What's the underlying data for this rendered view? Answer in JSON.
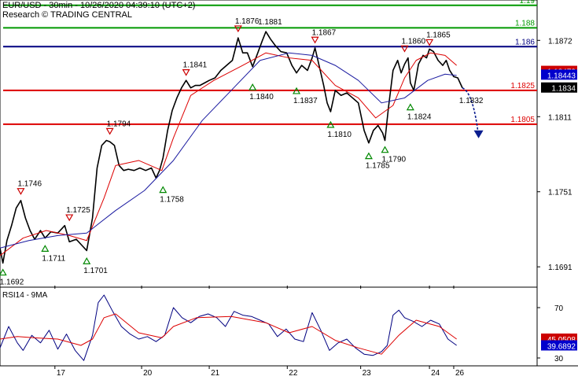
{
  "header": {
    "title": "EUR/USD - 30min - 10/26/2020 04:39:10 (UTC+2)",
    "subtitle": "Research © TRADING CENTRAL"
  },
  "colors": {
    "price": "#000000",
    "ma_fast": "#dd0000",
    "ma_slow": "#1a1aa0",
    "resistance": "#009900",
    "pivot": "#000080",
    "support": "#dd0000",
    "arrow": "#0a1d8f",
    "axis_box_pivot": "#0000cc",
    "axis_box_last": "#000000",
    "axis_box_red": "#cc0000",
    "tri_up": "#008800",
    "tri_down": "#cc0000"
  },
  "chart_data": [
    {
      "type": "line",
      "panel": "price",
      "title": "EUR/USD - 30min - 10/26/2020 04:39:10 (UTC+2)",
      "ylim": [
        1.1676,
        1.1903
      ],
      "y_ticks": [
        "1.1872",
        "1.1811",
        "1.1751",
        "1.1691"
      ],
      "y_tick_values": [
        1.1872,
        1.1811,
        1.1751,
        1.1691
      ],
      "x_ticks": [
        "17",
        "20",
        "21",
        "22",
        "23",
        "24",
        "26"
      ],
      "x_tick_values": [
        0.095,
        0.245,
        0.362,
        0.497,
        0.624,
        0.743,
        0.785
      ],
      "key_levels": [
        {
          "label": "1.19",
          "value": 1.19,
          "kind": "resistance"
        },
        {
          "label": "1.188",
          "value": 1.1882,
          "kind": "resistance"
        },
        {
          "label": "1.186",
          "value": 1.1867,
          "kind": "pivot"
        },
        {
          "label": "1.1825",
          "value": 1.1832,
          "kind": "support"
        },
        {
          "label": "1.1805",
          "value": 1.1805,
          "kind": "support"
        }
      ],
      "axis_boxes": [
        {
          "label": "1.18473",
          "value": 1.18473,
          "kind": "red"
        },
        {
          "label": "1.18443",
          "value": 1.18443,
          "kind": "pivot"
        },
        {
          "label": "1.1834",
          "value": 1.1834,
          "kind": "last"
        }
      ],
      "annotations": [
        {
          "label": "1.1692",
          "x": 0.005,
          "y": 1.1692,
          "marker": "up"
        },
        {
          "label": "1.1746",
          "x": 0.036,
          "y": 1.1746,
          "marker": "down"
        },
        {
          "label": "1.1711",
          "x": 0.078,
          "y": 1.1711,
          "marker": "up"
        },
        {
          "label": "1.1725",
          "x": 0.12,
          "y": 1.1725,
          "marker": "down"
        },
        {
          "label": "1.1701",
          "x": 0.15,
          "y": 1.1701,
          "marker": "up"
        },
        {
          "label": "1.1794",
          "x": 0.19,
          "y": 1.1794,
          "marker": "down"
        },
        {
          "label": "1.1758",
          "x": 0.282,
          "y": 1.1758,
          "marker": "up"
        },
        {
          "label": "1.1841",
          "x": 0.322,
          "y": 1.1841,
          "marker": "down"
        },
        {
          "label": "1.1876",
          "x": 0.412,
          "y": 1.1876,
          "marker": "down"
        },
        {
          "label": "1.1881",
          "x": 0.46,
          "y": 1.1881,
          "marker": "none"
        },
        {
          "label": "1.1840",
          "x": 0.437,
          "y": 1.184,
          "marker": "up"
        },
        {
          "label": "1.1867",
          "x": 0.545,
          "y": 1.1867,
          "marker": "down"
        },
        {
          "label": "1.1837",
          "x": 0.513,
          "y": 1.1837,
          "marker": "up"
        },
        {
          "label": "1.1810",
          "x": 0.572,
          "y": 1.181,
          "marker": "up"
        },
        {
          "label": "1.1785",
          "x": 0.638,
          "y": 1.1785,
          "marker": "up"
        },
        {
          "label": "1.1790",
          "x": 0.666,
          "y": 1.179,
          "marker": "up"
        },
        {
          "label": "1.1860",
          "x": 0.7,
          "y": 1.186,
          "marker": "down"
        },
        {
          "label": "1.1865",
          "x": 0.743,
          "y": 1.1865,
          "marker": "down"
        },
        {
          "label": "1.1824",
          "x": 0.71,
          "y": 1.1824,
          "marker": "up"
        },
        {
          "label": "1.1832",
          "x": 0.808,
          "y": 1.1832,
          "marker": "none"
        }
      ],
      "series": [
        {
          "role": "price",
          "x": [
            0.0,
            0.005,
            0.012,
            0.02,
            0.028,
            0.036,
            0.044,
            0.052,
            0.06,
            0.07,
            0.078,
            0.088,
            0.1,
            0.112,
            0.12,
            0.132,
            0.142,
            0.15,
            0.16,
            0.168,
            0.176,
            0.184,
            0.19,
            0.198,
            0.206,
            0.214,
            0.222,
            0.232,
            0.242,
            0.252,
            0.262,
            0.27,
            0.276,
            0.282,
            0.29,
            0.298,
            0.306,
            0.314,
            0.322,
            0.33,
            0.338,
            0.346,
            0.354,
            0.362,
            0.372,
            0.382,
            0.392,
            0.402,
            0.412,
            0.42,
            0.428,
            0.437,
            0.446,
            0.454,
            0.46,
            0.468,
            0.476,
            0.486,
            0.496,
            0.505,
            0.513,
            0.522,
            0.532,
            0.54,
            0.545,
            0.552,
            0.56,
            0.566,
            0.572,
            0.58,
            0.59,
            0.6,
            0.61,
            0.62,
            0.63,
            0.638,
            0.646,
            0.654,
            0.662,
            0.666,
            0.672,
            0.68,
            0.688,
            0.694,
            0.7,
            0.706,
            0.71,
            0.716,
            0.724,
            0.732,
            0.738,
            0.743,
            0.75,
            0.758,
            0.766,
            0.772,
            0.778,
            0.785,
            0.792,
            0.8
          ],
          "values": [
            1.1706,
            1.1694,
            1.1712,
            1.1724,
            1.1738,
            1.1744,
            1.173,
            1.172,
            1.1713,
            1.172,
            1.1714,
            1.1719,
            1.1718,
            1.1724,
            1.1711,
            1.1713,
            1.1708,
            1.1704,
            1.173,
            1.177,
            1.1788,
            1.1792,
            1.1791,
            1.1788,
            1.1772,
            1.1768,
            1.1769,
            1.1768,
            1.177,
            1.1768,
            1.177,
            1.1762,
            1.1768,
            1.1778,
            1.18,
            1.1816,
            1.1826,
            1.1834,
            1.184,
            1.1834,
            1.1836,
            1.1836,
            1.1838,
            1.184,
            1.1842,
            1.1848,
            1.1852,
            1.1856,
            1.1874,
            1.1862,
            1.1862,
            1.1851,
            1.1862,
            1.1872,
            1.1879,
            1.1873,
            1.1868,
            1.1863,
            1.1862,
            1.1852,
            1.1846,
            1.1852,
            1.1848,
            1.1858,
            1.1866,
            1.1852,
            1.1836,
            1.1822,
            1.1815,
            1.1832,
            1.1828,
            1.183,
            1.1826,
            1.1822,
            1.18,
            1.179,
            1.18,
            1.1804,
            1.1798,
            1.1792,
            1.1818,
            1.1848,
            1.1856,
            1.1846,
            1.1853,
            1.1858,
            1.1838,
            1.1832,
            1.1853,
            1.186,
            1.1858,
            1.1865,
            1.1863,
            1.1856,
            1.1852,
            1.1856,
            1.1848,
            1.1843,
            1.1842,
            1.1834
          ]
        },
        {
          "role": "ma_fast",
          "x": [
            0.0,
            0.04,
            0.08,
            0.12,
            0.15,
            0.18,
            0.2,
            0.24,
            0.28,
            0.3,
            0.33,
            0.37,
            0.42,
            0.46,
            0.5,
            0.54,
            0.58,
            0.62,
            0.65,
            0.68,
            0.7,
            0.72,
            0.745,
            0.77,
            0.79
          ],
          "values": [
            1.17,
            1.1714,
            1.172,
            1.1716,
            1.1712,
            1.1746,
            1.1772,
            1.1776,
            1.1768,
            1.1794,
            1.1828,
            1.184,
            1.1852,
            1.1862,
            1.1858,
            1.1856,
            1.1836,
            1.1826,
            1.181,
            1.182,
            1.1842,
            1.1856,
            1.1862,
            1.186,
            1.1852
          ]
        },
        {
          "role": "ma_slow",
          "x": [
            0.0,
            0.05,
            0.1,
            0.15,
            0.2,
            0.25,
            0.3,
            0.35,
            0.4,
            0.45,
            0.5,
            0.54,
            0.58,
            0.62,
            0.66,
            0.7,
            0.74,
            0.77,
            0.79
          ],
          "values": [
            1.1706,
            1.1712,
            1.1716,
            1.1718,
            1.1736,
            1.1752,
            1.1776,
            1.1808,
            1.1832,
            1.1856,
            1.1862,
            1.186,
            1.1852,
            1.184,
            1.1822,
            1.1826,
            1.184,
            1.1845,
            1.1844
          ]
        }
      ],
      "forecast_arrow": {
        "x": [
          0.8,
          0.828
        ],
        "values": [
          1.1834,
          1.1795
        ]
      }
    },
    {
      "type": "line",
      "panel": "rsi",
      "title": "RSI14 - 9MA",
      "ylim": [
        25,
        85
      ],
      "y_ticks": [
        "70",
        "30"
      ],
      "y_tick_values": [
        70,
        30
      ],
      "axis_boxes": [
        {
          "label": "45.0508",
          "value": 45.0508,
          "kind": "red"
        },
        {
          "label": "39.6892",
          "value": 39.6892,
          "kind": "pivot"
        }
      ],
      "series": [
        {
          "role": "rsi",
          "x": [
            0.0,
            0.015,
            0.03,
            0.04,
            0.055,
            0.07,
            0.085,
            0.1,
            0.115,
            0.13,
            0.145,
            0.16,
            0.17,
            0.18,
            0.195,
            0.21,
            0.225,
            0.24,
            0.255,
            0.27,
            0.285,
            0.3,
            0.315,
            0.33,
            0.345,
            0.36,
            0.375,
            0.39,
            0.405,
            0.42,
            0.435,
            0.45,
            0.465,
            0.48,
            0.495,
            0.51,
            0.525,
            0.54,
            0.555,
            0.57,
            0.585,
            0.6,
            0.615,
            0.63,
            0.645,
            0.66,
            0.67,
            0.68,
            0.69,
            0.7,
            0.715,
            0.73,
            0.745,
            0.76,
            0.775,
            0.79
          ],
          "values": [
            38,
            55,
            42,
            36,
            48,
            42,
            52,
            37,
            49,
            36,
            28,
            48,
            74,
            80,
            67,
            55,
            49,
            45,
            47,
            43,
            48,
            70,
            62,
            58,
            63,
            65,
            62,
            55,
            67,
            64,
            63,
            60,
            57,
            47,
            53,
            45,
            43,
            66,
            52,
            36,
            42,
            45,
            38,
            33,
            32,
            35,
            40,
            64,
            68,
            62,
            59,
            55,
            60,
            57,
            45,
            40
          ]
        },
        {
          "role": "rsi_ma",
          "x": [
            0.0,
            0.03,
            0.06,
            0.1,
            0.14,
            0.16,
            0.18,
            0.2,
            0.24,
            0.28,
            0.3,
            0.34,
            0.4,
            0.46,
            0.5,
            0.54,
            0.58,
            0.62,
            0.66,
            0.69,
            0.72,
            0.76,
            0.79
          ],
          "values": [
            45,
            47,
            46,
            45,
            40,
            45,
            62,
            65,
            50,
            46,
            55,
            62,
            63,
            58,
            50,
            55,
            44,
            38,
            33,
            48,
            60,
            55,
            45
          ]
        }
      ]
    }
  ]
}
